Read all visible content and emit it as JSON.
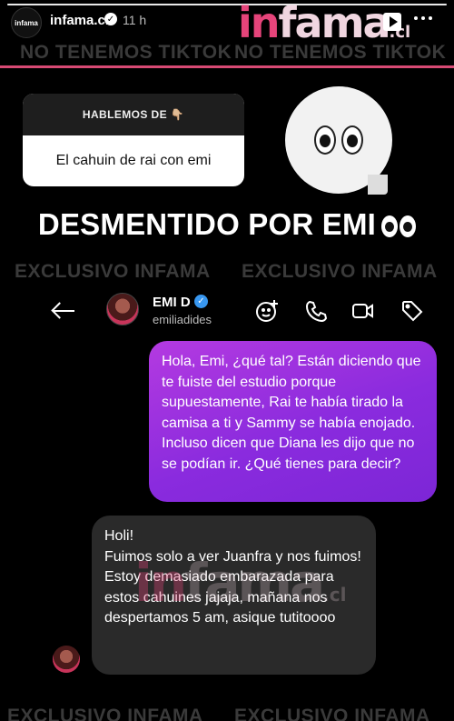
{
  "story": {
    "account_name": "infama.cl",
    "time_ago": "11 h",
    "avatar_text": "infama",
    "progress_percent": 100
  },
  "brand": {
    "logo_prefix": "in",
    "logo_rest": "fama",
    "logo_tld": ".cl"
  },
  "watermarks": {
    "tiktok": "NO TENEMOS TIKTOK",
    "exclusive": "EXCLUSIVO INFAMA"
  },
  "question_sticker": {
    "header": "HABLEMOS DE 👇🏼",
    "question": "El cahuin de rai con emi"
  },
  "headline": {
    "text": "DESMENTIDO POR EMI"
  },
  "chat": {
    "name": "EMI D",
    "handle": "emiliadides",
    "outgoing_message": "Hola, Emi, ¿qué tal? Están diciendo que te fuiste del estudio porque supuestamente, Rai te había tirado la camisa a ti y Sammy se había enojado. Incluso dicen que Diana les dijo que no se podían ir. ¿Qué tienes para decir?",
    "incoming_message": "Holi!\nFuimos solo a ver Juanfra y nos fuimos!\nEstoy demasiado embarazada para estos cahuines jajaja, mañana nos despertamos 5 am, asique tutitoooo"
  },
  "colors": {
    "accent_pink": "#d84a74",
    "outgoing_bubble": "#8a2bde",
    "incoming_bubble": "#2a2a2a",
    "verified_blue": "#3897f0"
  },
  "icons": {
    "back": "back-arrow-icon",
    "add_sticker": "sticker-add-icon",
    "call": "phone-icon",
    "video": "video-icon",
    "tag": "tag-icon",
    "verified": "verified-badge-icon",
    "play": "play-icon",
    "more": "more-options-icon"
  }
}
